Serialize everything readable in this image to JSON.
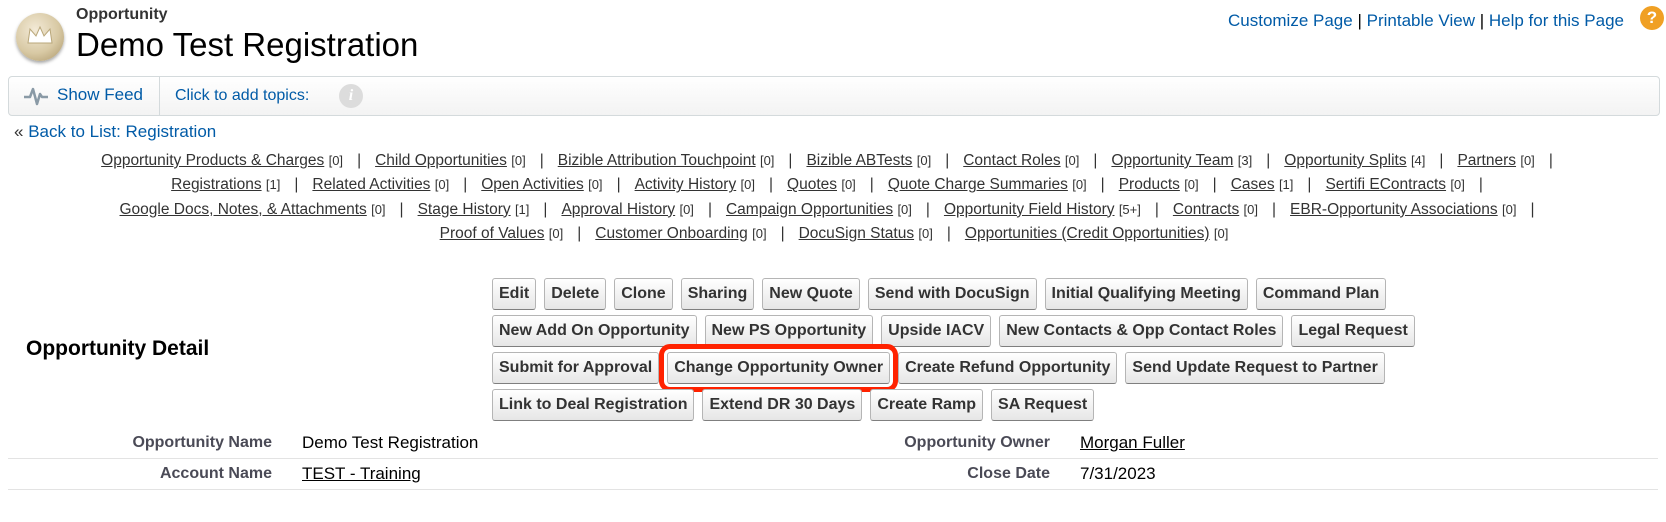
{
  "header": {
    "object_type": "Opportunity",
    "title": "Demo Test Registration",
    "links": [
      "Customize Page",
      "Printable View",
      "Help for this Page"
    ],
    "link_separator": "|",
    "help_glyph": "?"
  },
  "feed": {
    "show_feed": "Show Feed",
    "topics": "Click to add topics:",
    "info_glyph": "i"
  },
  "back": {
    "prefix": "«",
    "label": "Back to List: Registration"
  },
  "related_links": [
    [
      {
        "label": "Opportunity Products & Charges",
        "count": "[0]"
      },
      {
        "label": "Child Opportunities",
        "count": "[0]"
      },
      {
        "label": "Bizible Attribution Touchpoint",
        "count": "[0]"
      },
      {
        "label": "Bizible ABTests",
        "count": "[0]"
      },
      {
        "label": "Contact Roles",
        "count": "[0]"
      },
      {
        "label": "Opportunity Team",
        "count": "[3]"
      },
      {
        "label": "Opportunity Splits",
        "count": "[4]"
      },
      {
        "label": "Partners",
        "count": "[0]"
      }
    ],
    [
      {
        "label": "Registrations",
        "count": "[1]"
      },
      {
        "label": "Related Activities",
        "count": "[0]"
      },
      {
        "label": "Open Activities",
        "count": "[0]"
      },
      {
        "label": "Activity History",
        "count": "[0]"
      },
      {
        "label": "Quotes",
        "count": "[0]"
      },
      {
        "label": "Quote Charge Summaries",
        "count": "[0]"
      },
      {
        "label": "Products",
        "count": "[0]"
      },
      {
        "label": "Cases",
        "count": "[1]"
      },
      {
        "label": "Sertifi EContracts",
        "count": "[0]"
      }
    ],
    [
      {
        "label": "Google Docs, Notes, & Attachments",
        "count": "[0]"
      },
      {
        "label": "Stage History",
        "count": "[1]"
      },
      {
        "label": "Approval History",
        "count": "[0]"
      },
      {
        "label": "Campaign Opportunities",
        "count": "[0]"
      },
      {
        "label": "Opportunity Field History",
        "count": "[5+]"
      },
      {
        "label": "Contracts",
        "count": "[0]"
      },
      {
        "label": "EBR-Opportunity Associations",
        "count": "[0]"
      }
    ],
    [
      {
        "label": "Proof of Values",
        "count": "[0]"
      },
      {
        "label": "Customer Onboarding",
        "count": "[0]"
      },
      {
        "label": "DocuSign Status",
        "count": "[0]"
      },
      {
        "label": "Opportunities (Credit Opportunities)",
        "count": "[0]"
      }
    ]
  ],
  "related_trailing_pipe": [
    true,
    true,
    true,
    false
  ],
  "detail": {
    "title": "Opportunity Detail",
    "buttons": [
      [
        "Edit",
        "Delete",
        "Clone",
        "Sharing",
        "New Quote",
        "Send with DocuSign",
        "Initial Qualifying Meeting",
        "Command Plan"
      ],
      [
        "New Add On Opportunity",
        "New PS Opportunity",
        "Upside IACV",
        "New Contacts & Opp Contact Roles",
        "Legal Request"
      ],
      [
        "Submit for Approval",
        "Change Opportunity Owner",
        "Create Refund Opportunity",
        "Send Update Request to Partner"
      ],
      [
        "Link to Deal Registration",
        "Extend DR 30 Days",
        "Create Ramp",
        "SA Request"
      ]
    ],
    "highlighted_button": "Change Opportunity Owner",
    "highlight_color": "#ff2200",
    "fields": [
      {
        "label": "Opportunity Name",
        "value": "Demo Test Registration",
        "link": false,
        "label2": "Opportunity Owner",
        "value2": "Morgan Fuller",
        "link2": true
      },
      {
        "label": "Account Name",
        "value": "TEST - Training",
        "link": true,
        "label2": "Close Date",
        "value2": "7/31/2023",
        "link2": false
      }
    ]
  }
}
